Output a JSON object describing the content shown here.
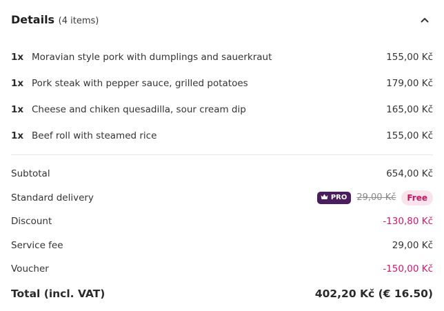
{
  "details": {
    "title": "Details",
    "count": "(4 items)"
  },
  "items": [
    {
      "qty": "1x",
      "name": "Moravian style pork with dumplings and sauerkraut",
      "price": "155,00 Kč"
    },
    {
      "qty": "1x",
      "name": "Pork steak with pepper sauce, grilled potatoes",
      "price": "179,00 Kč"
    },
    {
      "qty": "1x",
      "name": "Cheese and chiken quesadilla, sour cream dip",
      "price": "165,00 Kč"
    },
    {
      "qty": "1x",
      "name": "Beef roll with steamed rice",
      "price": "155,00 Kč"
    }
  ],
  "summary": {
    "subtotal_label": "Subtotal",
    "subtotal_value": "654,00 Kč",
    "delivery_label": "Standard delivery",
    "delivery_pro": "PRO",
    "delivery_old_price": "29,00 Kč",
    "delivery_value": "Free",
    "discount_label": "Discount",
    "discount_value": "-130,80 Kč",
    "service_label": "Service fee",
    "service_value": "29,00 Kč",
    "voucher_label": "Voucher",
    "voucher_value": "-150,00 Kč",
    "total_label": "Total (incl. VAT)",
    "total_value": "402,20 Kč (€ 16.50)"
  },
  "colors": {
    "accent": "#d6156b",
    "pro_badge": "#4a1d5c",
    "free_bg": "#fbe3ec"
  },
  "icons": {
    "collapse": "chevron-up-icon",
    "pro": "crown-icon"
  }
}
